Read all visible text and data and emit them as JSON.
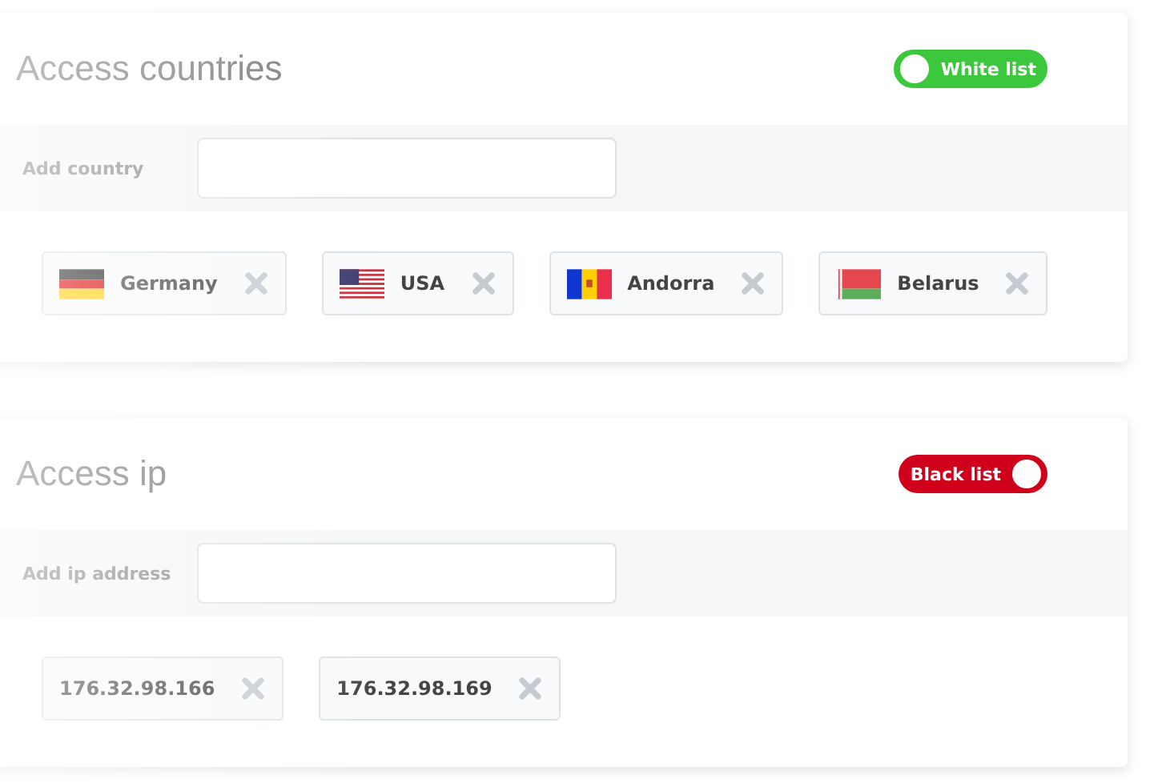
{
  "sections": [
    {
      "title": "Access countries",
      "toggle": {
        "label": "White list",
        "on": true
      },
      "input_label": "Add country",
      "chips": [
        {
          "label": "Germany",
          "kind": "de"
        },
        {
          "label": "USA",
          "kind": "us"
        },
        {
          "label": "Andorra",
          "kind": "ad"
        },
        {
          "label": "Belarus",
          "kind": "by"
        }
      ]
    },
    {
      "title": "Access ip",
      "toggle": {
        "label": "Black list",
        "on": false
      },
      "input_label": "Add ip address",
      "chips": [
        {
          "label": "176.32.98.166"
        },
        {
          "label": "176.32.98.169"
        }
      ]
    }
  ]
}
